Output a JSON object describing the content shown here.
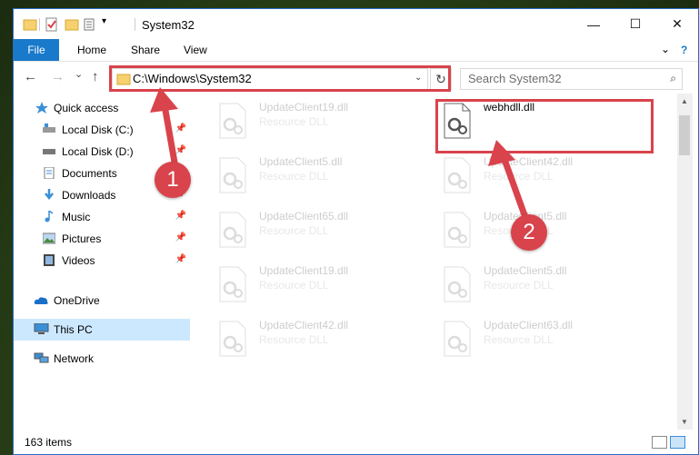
{
  "window": {
    "title": "System32",
    "minimize": "—",
    "maximize": "☐",
    "close": "✕"
  },
  "ribbon": {
    "tabs": [
      "File",
      "Home",
      "Share",
      "View"
    ],
    "collapse": "⌄",
    "help": "?"
  },
  "nav": {
    "back": "←",
    "forward": "→",
    "recent": "⌄",
    "up": "↑",
    "address": "C:\\Windows\\System32",
    "address_dropdown": "⌄",
    "refresh": "↻",
    "search_placeholder": "Search System32",
    "search_icon": "⌕"
  },
  "sidebar": {
    "items": [
      {
        "label": "Quick access",
        "icon": "star-icon"
      },
      {
        "label": "Local Disk (C:)",
        "icon": "drive-icon",
        "pinned": true
      },
      {
        "label": "Local Disk (D:)",
        "icon": "drive-icon",
        "pinned": true
      },
      {
        "label": "Documents",
        "icon": "documents-icon",
        "pinned": true
      },
      {
        "label": "Downloads",
        "icon": "download-icon",
        "pinned": true
      },
      {
        "label": "Music",
        "icon": "music-icon",
        "pinned": true
      },
      {
        "label": "Pictures",
        "icon": "pictures-icon",
        "pinned": true
      },
      {
        "label": "Videos",
        "icon": "videos-icon",
        "pinned": true
      },
      {
        "label": "OneDrive",
        "icon": "cloud-icon"
      },
      {
        "label": "This PC",
        "icon": "computer-icon",
        "selected": true
      },
      {
        "label": "Network",
        "icon": "network-icon"
      }
    ],
    "pin_glyph": "📌"
  },
  "files": {
    "left": [
      {
        "name": "UpdateClient19.dll",
        "type": "Resource DLL"
      },
      {
        "name": "UpdateClient5.dll",
        "type": "Resource DLL"
      },
      {
        "name": "UpdateClient65.dll",
        "type": "Resource DLL"
      },
      {
        "name": "UpdateClient19.dll",
        "type": "Resource DLL"
      },
      {
        "name": "UpdateClient42.dll",
        "type": "Resource DLL"
      }
    ],
    "right": [
      {
        "name": "webhdll.dll",
        "type": ""
      },
      {
        "name": "UpdateClient42.dll",
        "type": "Resource DLL"
      },
      {
        "name": "UpdateClient5.dll",
        "type": "Resource DLL"
      },
      {
        "name": "UpdateClient5.dll",
        "type": "Resource DLL"
      },
      {
        "name": "UpdateClient63.dll",
        "type": "Resource DLL"
      }
    ]
  },
  "status": {
    "count": "163 items"
  },
  "annotations": {
    "badge1": "1",
    "badge2": "2",
    "color": "#d9434b"
  },
  "colors": {
    "accent": "#1979ca",
    "selected": "#cce8ff"
  }
}
